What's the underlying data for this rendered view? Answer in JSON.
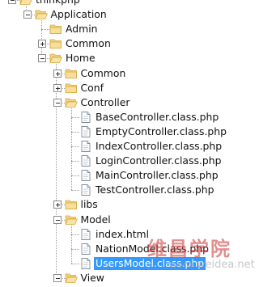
{
  "colors": {
    "folder": "#f3d382",
    "folder_edge": "#d8a93c",
    "selection": "#3399ff"
  },
  "tree": [
    {
      "label": "thinkphp",
      "level": 0,
      "kind": "folder",
      "open": true,
      "expander": "minus"
    },
    {
      "label": "Application",
      "level": 1,
      "kind": "folder",
      "open": true,
      "expander": "minus"
    },
    {
      "label": "Admin",
      "level": 2,
      "kind": "folder",
      "open": false,
      "expander": "none"
    },
    {
      "label": "Common",
      "level": 2,
      "kind": "folder",
      "open": false,
      "expander": "plus"
    },
    {
      "label": "Home",
      "level": 2,
      "kind": "folder",
      "open": true,
      "expander": "minus"
    },
    {
      "label": "Common",
      "level": 3,
      "kind": "folder",
      "open": false,
      "expander": "plus"
    },
    {
      "label": "Conf",
      "level": 3,
      "kind": "folder",
      "open": false,
      "expander": "plus"
    },
    {
      "label": "Controller",
      "level": 3,
      "kind": "folder",
      "open": true,
      "expander": "minus"
    },
    {
      "label": "BaseController.class.php",
      "level": 4,
      "kind": "file",
      "expander": "none"
    },
    {
      "label": "EmptyController.class.php",
      "level": 4,
      "kind": "file",
      "expander": "none"
    },
    {
      "label": "IndexController.class.php",
      "level": 4,
      "kind": "file",
      "expander": "none"
    },
    {
      "label": "LoginController.class.php",
      "level": 4,
      "kind": "file",
      "expander": "none"
    },
    {
      "label": "MainController.class.php",
      "level": 4,
      "kind": "file",
      "expander": "none"
    },
    {
      "label": "TestController.class.php",
      "level": 4,
      "kind": "file",
      "expander": "none"
    },
    {
      "label": "libs",
      "level": 3,
      "kind": "folder",
      "open": false,
      "expander": "plus"
    },
    {
      "label": "Model",
      "level": 3,
      "kind": "folder",
      "open": true,
      "expander": "minus"
    },
    {
      "label": "index.html",
      "level": 4,
      "kind": "file",
      "expander": "none"
    },
    {
      "label": "NationModel.class.php",
      "level": 4,
      "kind": "file",
      "expander": "none"
    },
    {
      "label": "UsersModel.class.php",
      "level": 4,
      "kind": "file",
      "expander": "none",
      "selected": true
    },
    {
      "label": "View",
      "level": 3,
      "kind": "folder",
      "open": true,
      "expander": "minus"
    }
  ],
  "watermark": {
    "text": "维昌学院",
    "sub": "www.weidea.net"
  }
}
